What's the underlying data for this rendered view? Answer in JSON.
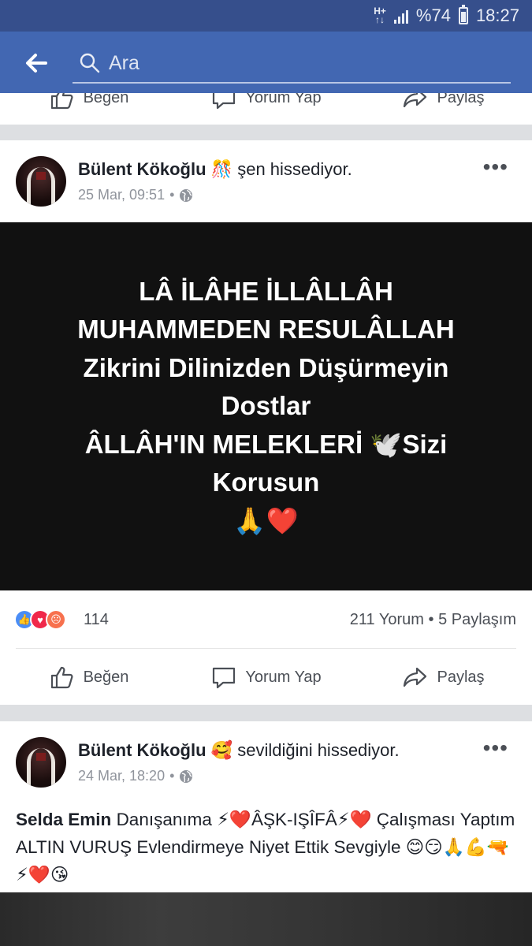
{
  "status_bar": {
    "network_type_top": "H+",
    "network_type_bottom": "↑↓",
    "battery_percent": "%74",
    "time": "18:27"
  },
  "search": {
    "placeholder": "Ara"
  },
  "actions": {
    "like": "Beğen",
    "comment": "Yorum Yap",
    "share": "Paylaş"
  },
  "posts": [
    {
      "author": "Bülent Kökoğlu",
      "feeling_emoji": "🎊",
      "feeling": "şen hissediyor.",
      "date": "25 Mar, 09:51",
      "separator": "•",
      "more": "•••",
      "text_lines": [
        "LÂ İLÂHE İLLÂLLÂH",
        "MUHAMMEDEN RESULÂLLAH",
        "Zikrini Dilinizden Düşürmeyin",
        "Dostlar",
        "ÂLLÂH'IN MELEKLERİ 🕊️Sizi",
        "Korusun",
        "🙏❤️"
      ],
      "reaction_count": "114",
      "comments": "211 Yorum",
      "dot": "•",
      "shares": "5 Paylaşım"
    },
    {
      "author": "Bülent Kökoğlu",
      "feeling_emoji": "🥰",
      "feeling": "sevildiğini hissediyor.",
      "date": "24 Mar, 18:20",
      "separator": "•",
      "more": "•••",
      "mention": "Selda Emin",
      "text": "Danışanıma ⚡❤️ÂŞK-IŞÎFÂ⚡❤️ Çalışması Yaptım ALTIN VURUŞ Evlendirmeye Niyet Ettik Sevgiyle 😊😏🙏💪🔫⚡❤️😘"
    }
  ]
}
